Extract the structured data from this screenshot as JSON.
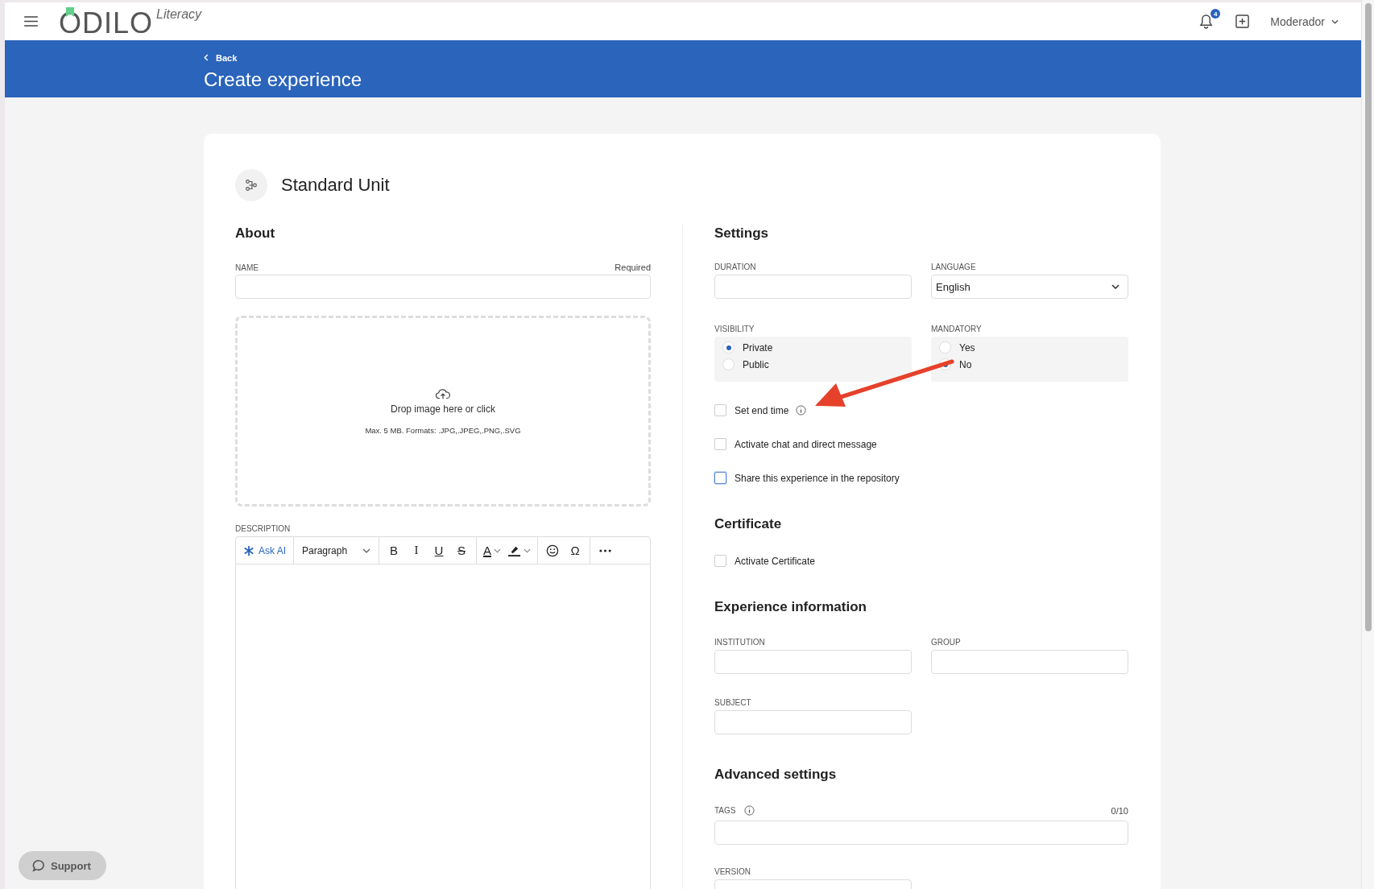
{
  "header": {
    "logo": "ODILO",
    "logo_tagline": "Literacy",
    "notification_count": "4",
    "user": "Moderador"
  },
  "banner": {
    "back": "Back",
    "title": "Create experience"
  },
  "unit": {
    "title": "Standard Unit"
  },
  "about": {
    "heading": "About",
    "name_field": {
      "label": "NAME",
      "hint": "Required"
    },
    "dropzone": {
      "text": "Drop image here or click",
      "formats": "Max. 5 MB. Formats: .JPG,.JPEG,.PNG,.SVG"
    },
    "description": {
      "label": "DESCRIPTION",
      "ask_ai": "Ask AI",
      "block_format": "Paragraph",
      "toolbar_groups": [
        [
          {
            "kind": "bold",
            "glyph": "B"
          },
          {
            "kind": "italic",
            "glyph": "I"
          },
          {
            "kind": "underline",
            "glyph": "U"
          },
          {
            "kind": "strike",
            "glyph": "S"
          }
        ],
        [
          {
            "kind": "text_color",
            "glyph": "A"
          },
          {
            "kind": "highlight"
          }
        ],
        [
          {
            "kind": "emoji"
          },
          {
            "kind": "symbol",
            "glyph": "Ω"
          }
        ],
        [
          {
            "kind": "more"
          }
        ]
      ]
    }
  },
  "settings": {
    "heading": "Settings",
    "duration": {
      "label": "DURATION"
    },
    "language": {
      "label": "LANGUAGE",
      "value": "English"
    },
    "visibility": {
      "label": "VISIBILITY",
      "options": [
        {
          "label": "Private",
          "selected": true
        },
        {
          "label": "Public",
          "selected": false
        }
      ]
    },
    "mandatory": {
      "label": "MANDATORY",
      "options": [
        {
          "label": "Yes",
          "selected": false
        },
        {
          "label": "No",
          "selected": true
        }
      ]
    },
    "checkboxes": [
      {
        "label": "Set end time",
        "checked": false,
        "info": true,
        "focused": false
      },
      {
        "label": "Activate chat and direct message",
        "checked": false,
        "info": false,
        "focused": false
      },
      {
        "label": "Share this experience in the repository",
        "checked": false,
        "info": false,
        "focused": true
      }
    ]
  },
  "certificate": {
    "heading": "Certificate",
    "checkboxes": [
      {
        "label": "Activate Certificate",
        "checked": false,
        "info": false,
        "focused": false
      }
    ]
  },
  "experience_information": {
    "heading": "Experience information",
    "fields": [
      {
        "label": "INSTITUTION"
      },
      {
        "label": "GROUP"
      },
      {
        "label": "SUBJECT"
      }
    ]
  },
  "advanced_settings": {
    "heading": "Advanced settings",
    "tags": {
      "label": "TAGS",
      "count": "0/10"
    },
    "version": {
      "label": "VERSION"
    }
  },
  "support": {
    "label": "Support"
  }
}
